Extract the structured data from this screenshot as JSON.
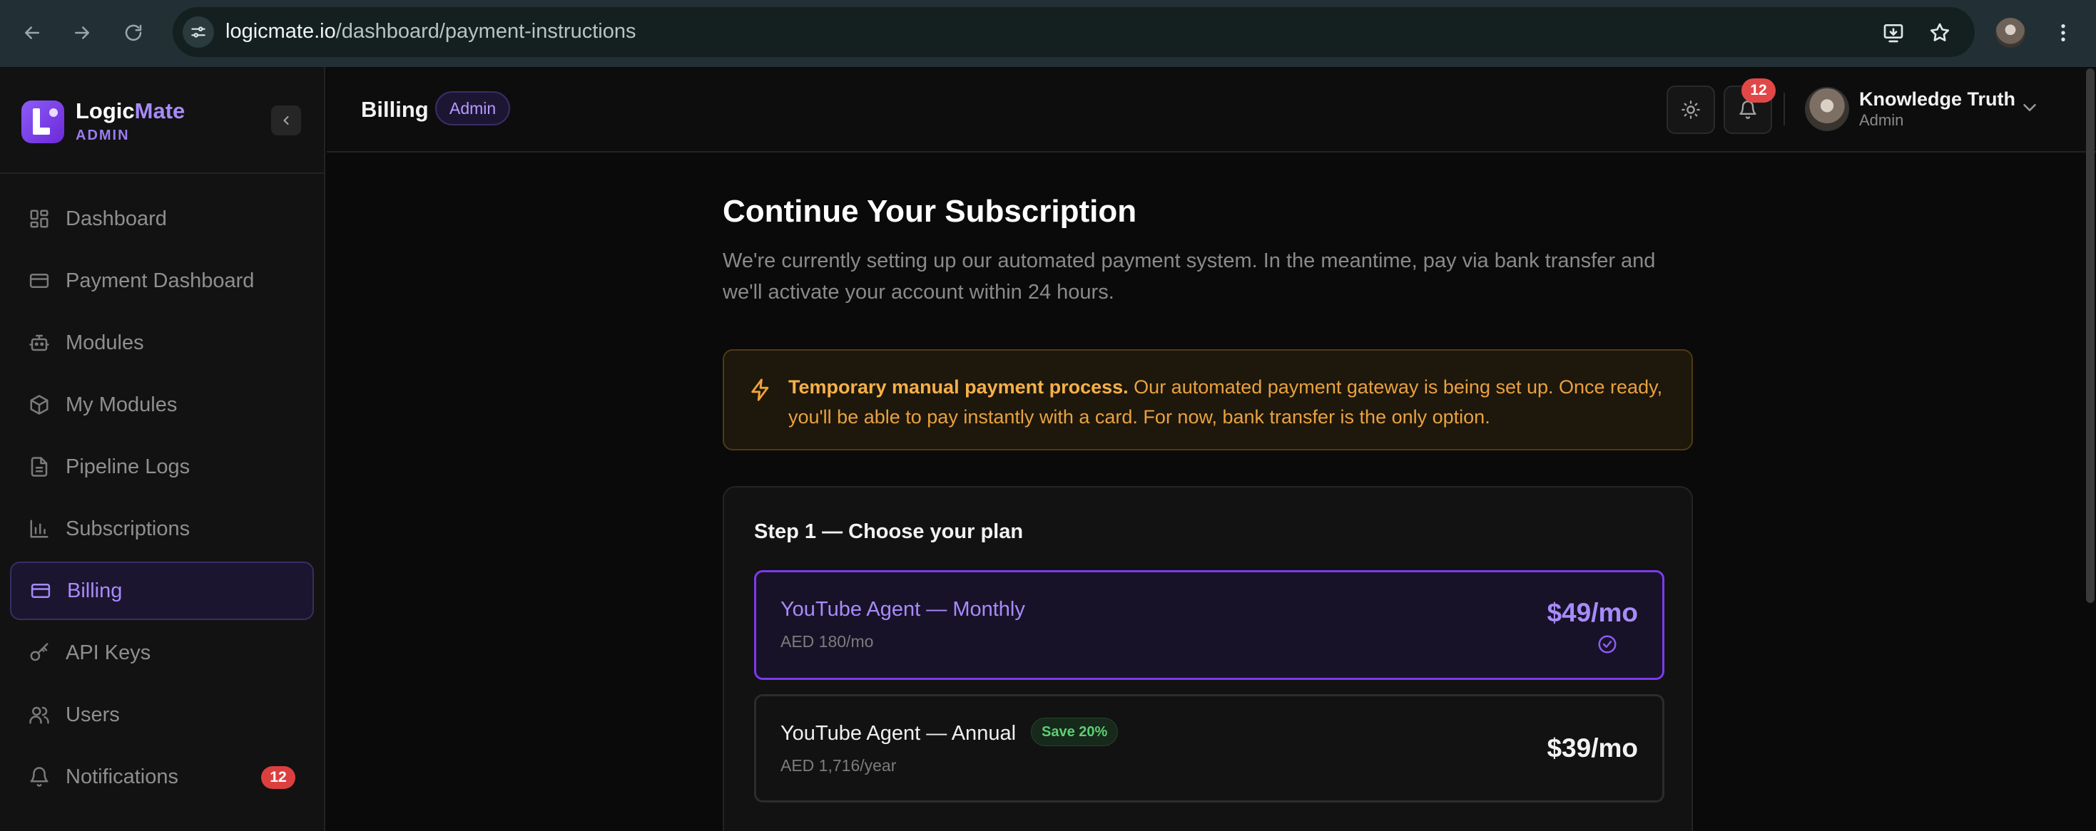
{
  "browser": {
    "url_host": "logicmate.io",
    "url_path": "/dashboard/payment-instructions"
  },
  "brand": {
    "name_part1": "Logic",
    "name_part2": "Mate",
    "subtitle": "ADMIN"
  },
  "sidebar": {
    "items": [
      {
        "label": "Dashboard",
        "icon": "grid-icon"
      },
      {
        "label": "Payment Dashboard",
        "icon": "credit-card-icon"
      },
      {
        "label": "Modules",
        "icon": "bot-icon"
      },
      {
        "label": "My Modules",
        "icon": "box-icon"
      },
      {
        "label": "Pipeline Logs",
        "icon": "file-text-icon"
      },
      {
        "label": "Subscriptions",
        "icon": "bar-chart-icon"
      },
      {
        "label": "Billing",
        "icon": "credit-card-icon",
        "active": true
      },
      {
        "label": "API Keys",
        "icon": "key-icon"
      },
      {
        "label": "Users",
        "icon": "users-icon"
      },
      {
        "label": "Notifications",
        "icon": "bell-icon",
        "badge": "12"
      }
    ]
  },
  "header": {
    "title": "Billing",
    "role_pill": "Admin",
    "notification_count": "12",
    "user_name": "Knowledge Truth",
    "user_role": "Admin"
  },
  "main": {
    "heading": "Continue Your Subscription",
    "lead": "We're currently setting up our automated payment system. In the meantime, pay via bank transfer and we'll activate your account within 24 hours.",
    "notice_bold": "Temporary manual payment process.",
    "notice_text": " Our automated payment gateway is being set up. Once ready, you'll be able to pay instantly with a card. For now, bank transfer is the only option.",
    "step1_title": "Step 1 — Choose your plan",
    "plans": [
      {
        "name": "YouTube Agent — Monthly",
        "sub": "AED 180/mo",
        "price": "$49/mo",
        "selected": true
      },
      {
        "name": "YouTube Agent — Annual",
        "sub": "AED 1,716/year",
        "price": "$39/mo",
        "badge": "Save 20%",
        "selected": false
      }
    ]
  },
  "colors": {
    "accent": "#a78bfa",
    "accent_border": "#7c3aed",
    "warning": "#e8a240",
    "danger": "#e04848",
    "success": "#5ccf74"
  }
}
